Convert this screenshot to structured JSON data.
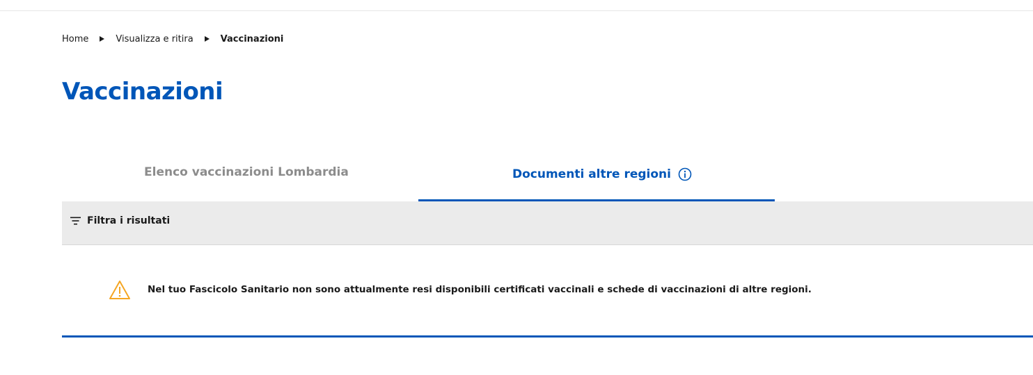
{
  "breadcrumb": {
    "items": [
      "Home",
      "Visualizza e ritira"
    ],
    "current": "Vaccinazioni"
  },
  "page": {
    "title": "Vaccinazioni"
  },
  "tabs": [
    {
      "label": "Elenco vaccinazioni Lombardia",
      "active": false
    },
    {
      "label": "Documenti altre regioni",
      "active": true,
      "icon": "info-icon"
    }
  ],
  "filter": {
    "label": "Filtra i risultati",
    "icon": "filter-icon"
  },
  "alert": {
    "icon": "warning-icon",
    "message": "Nel tuo Fascicolo Sanitario non sono attualmente resi disponibili certificati vaccinali e schede di vaccinazioni di altre regioni."
  },
  "colors": {
    "primary": "#0056b8",
    "tab_inactive": "#8c8c8c",
    "filter_background": "#ebebeb",
    "warning": "#f5a623"
  }
}
